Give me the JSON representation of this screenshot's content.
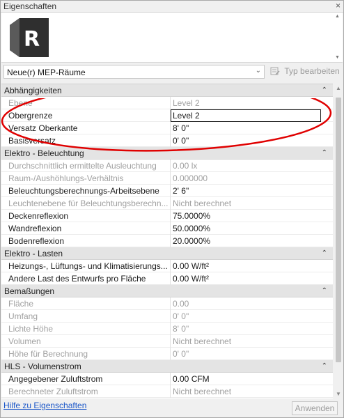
{
  "window": {
    "title": "Eigenschaften",
    "close_glyph": "×"
  },
  "type_selector": {
    "logo_letter": "R",
    "selected_type": "Neue(r) MEP-Räume",
    "edit_type_label": "Typ bearbeiten"
  },
  "groups": [
    {
      "name": "Abhängigkeiten",
      "rows": [
        {
          "name": "Ebene",
          "value": "Level 2",
          "disabled": true
        },
        {
          "name": "Obergrenze",
          "value": "Level 2",
          "disabled": false,
          "active": true
        },
        {
          "name": "Versatz Oberkante",
          "value": "8'  0\"",
          "disabled": false
        },
        {
          "name": "Basisversatz",
          "value": "0'  0\"",
          "disabled": false
        }
      ]
    },
    {
      "name": "Elektro - Beleuchtung",
      "rows": [
        {
          "name": "Durchschnittlich ermittelte Ausleuchtung",
          "value": "0.00 lx",
          "disabled": true
        },
        {
          "name": "Raum-/Aushöhlungs-Verhältnis",
          "value": "0.000000",
          "disabled": true
        },
        {
          "name": "Beleuchtungsberechnungs-Arbeitsebene",
          "value": "2'  6\"",
          "disabled": false
        },
        {
          "name": "Leuchtenebene für Beleuchtungsberechn...",
          "value": "Nicht berechnet",
          "disabled": true
        },
        {
          "name": "Deckenreflexion",
          "value": "75.0000%",
          "disabled": false
        },
        {
          "name": "Wandreflexion",
          "value": "50.0000%",
          "disabled": false
        },
        {
          "name": "Bodenreflexion",
          "value": "20.0000%",
          "disabled": false
        }
      ]
    },
    {
      "name": "Elektro - Lasten",
      "rows": [
        {
          "name": "Heizungs-, Lüftungs- und Klimatisierungs...",
          "value": "0.00 W/ft²",
          "disabled": false
        },
        {
          "name": "Andere Last des Entwurfs pro Fläche",
          "value": "0.00 W/ft²",
          "disabled": false
        }
      ]
    },
    {
      "name": "Bemaßungen",
      "rows": [
        {
          "name": "Fläche",
          "value": "0.00",
          "disabled": true
        },
        {
          "name": "Umfang",
          "value": "0'  0\"",
          "disabled": true
        },
        {
          "name": "Lichte Höhe",
          "value": "8'  0\"",
          "disabled": true
        },
        {
          "name": "Volumen",
          "value": "Nicht berechnet",
          "disabled": true
        },
        {
          "name": "Höhe für Berechnung",
          "value": "0'  0\"",
          "disabled": true
        }
      ]
    },
    {
      "name": "HLS - Volumenstrom",
      "rows": [
        {
          "name": "Angegebener Zuluftstrom",
          "value": "0.00 CFM",
          "disabled": false
        },
        {
          "name": "Berechneter Zuluftstrom",
          "value": "Nicht berechnet",
          "disabled": true
        }
      ]
    }
  ],
  "footer": {
    "help_link": "Hilfe zu Eigenschaften",
    "apply_label": "Anwenden"
  },
  "colors": {
    "annotation_ellipse": "#e00000",
    "link": "#1a56c8",
    "disabled_text": "#a0a0a0"
  },
  "icons": {
    "collapse": "chevron-up-double",
    "dropdown": "chevron-down",
    "edit_type": "edit-type-icon"
  }
}
